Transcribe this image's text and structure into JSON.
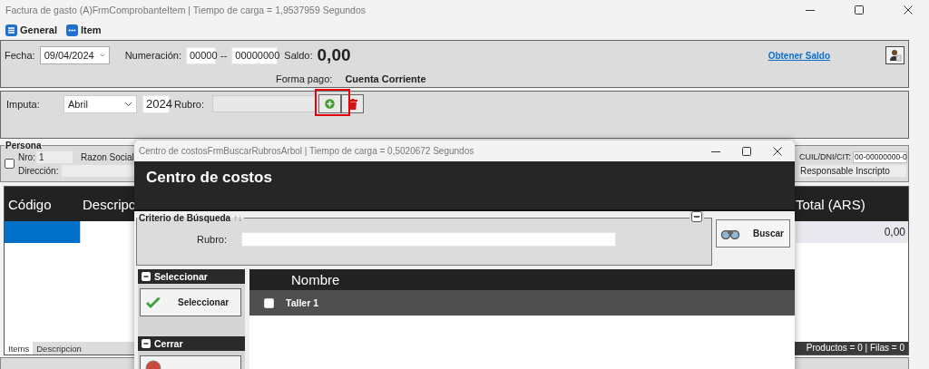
{
  "window": {
    "title": "Factura de gasto (A)FrmComprobanteItem | Tiempo de carga = 1,9537959 Segundos"
  },
  "toolbar": [
    {
      "label": "General",
      "kind": "list"
    },
    {
      "label": "Item",
      "kind": "dots"
    }
  ],
  "header": {
    "fecha_label": "Fecha:",
    "fecha": "09/04/2024",
    "numeracion_label": "Numeración:",
    "punto_venta": "00000",
    "separator": "--",
    "numero": "00000000",
    "saldo_label": "Saldo:",
    "saldo": "0,00",
    "link": "Obtener Saldo",
    "forma_pago_label": "Forma pago:",
    "forma_pago": "Cuenta Corriente"
  },
  "imputa": {
    "label": "Imputa:",
    "month": "Abril",
    "year": "2024",
    "rubro_label": "Rubro:",
    "add_highlighted": true
  },
  "persona": {
    "legend": "Persona",
    "checked": false,
    "nro_label": "Nro:",
    "nro": "1",
    "razon_label": "Razon Social",
    "direccion_label": "Dirección:",
    "cuit_label": "CUIL/DNI/CIT:",
    "cuit": "00-00000000-0",
    "condicion": "Responsable Inscripto"
  },
  "grid": {
    "columns": [
      "Código",
      "Descripc",
      "Total (ARS)"
    ],
    "rows": [
      {
        "total": "0,00",
        "selected": true
      }
    ],
    "tabs": [
      {
        "label": "Items",
        "selected": true
      },
      {
        "label": "Descripcion",
        "selected": false
      }
    ],
    "status": "Productos = 0 | Filas = 0"
  },
  "dialog": {
    "title": "Centro de costosFrmBuscarRubrosArbol | Tiempo de carga = 0,5020672 Segundos",
    "heading": "Centro de costos",
    "criteria_legend": "Criterio de Búsqueda",
    "sort_arrows": "↑↓",
    "rubro_label": "Rubro:",
    "search_button": "Buscar",
    "sections": [
      {
        "title": "Seleccionar",
        "button": "Seleccionar",
        "kind": "select"
      },
      {
        "title": "Cerrar",
        "kind": "close"
      }
    ],
    "columns": [
      "Nombre"
    ],
    "rows": [
      {
        "name": "Taller 1",
        "checked": false,
        "selected": true
      }
    ]
  }
}
